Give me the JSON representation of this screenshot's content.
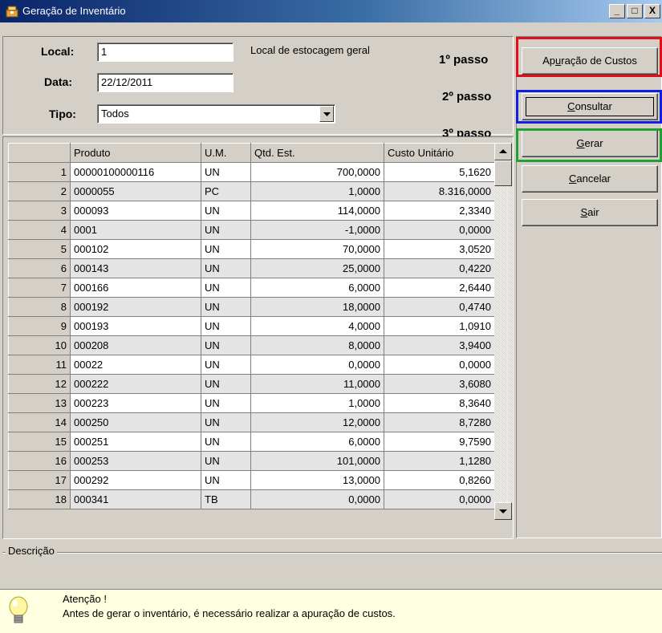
{
  "window": {
    "title": "Geração de Inventário",
    "minimize": "_",
    "maximize": "□",
    "close": "X"
  },
  "form": {
    "local_label": "Local:",
    "local_value": "1",
    "local_desc": "Local de estocagem geral",
    "data_label": "Data:",
    "data_value": "22/12/2011",
    "tipo_label": "Tipo:",
    "tipo_value": "Todos"
  },
  "steps": {
    "s1": "1º passo",
    "s2": "2º passo",
    "s3": "3º passo"
  },
  "buttons": {
    "apuracao_pre": "Ap",
    "apuracao_u": "u",
    "apuracao_post": "ração de Custos",
    "consultar_u": "C",
    "consultar_post": "onsultar",
    "gerar_u": "G",
    "gerar_post": "erar",
    "cancelar_u": "C",
    "cancelar_post": "ancelar",
    "sair_u": "S",
    "sair_post": "air"
  },
  "highlight_colors": {
    "step1": "#e0101a",
    "step2": "#1020e0",
    "step3": "#20a030"
  },
  "grid": {
    "columns": [
      "Produto",
      "U.M.",
      "Qtd. Est.",
      "Custo Unitário"
    ],
    "rows": [
      {
        "n": "1",
        "produto": "00000100000116",
        "um": "UN",
        "qtd": "700,0000",
        "custo": "5,1620"
      },
      {
        "n": "2",
        "produto": "0000055",
        "um": "PC",
        "qtd": "1,0000",
        "custo": "8.316,0000"
      },
      {
        "n": "3",
        "produto": "000093",
        "um": "UN",
        "qtd": "114,0000",
        "custo": "2,3340"
      },
      {
        "n": "4",
        "produto": "0001",
        "um": "UN",
        "qtd": "-1,0000",
        "custo": "0,0000"
      },
      {
        "n": "5",
        "produto": "000102",
        "um": "UN",
        "qtd": "70,0000",
        "custo": "3,0520"
      },
      {
        "n": "6",
        "produto": "000143",
        "um": "UN",
        "qtd": "25,0000",
        "custo": "0,4220"
      },
      {
        "n": "7",
        "produto": "000166",
        "um": "UN",
        "qtd": "6,0000",
        "custo": "2,6440"
      },
      {
        "n": "8",
        "produto": "000192",
        "um": "UN",
        "qtd": "18,0000",
        "custo": "0,4740"
      },
      {
        "n": "9",
        "produto": "000193",
        "um": "UN",
        "qtd": "4,0000",
        "custo": "1,0910"
      },
      {
        "n": "10",
        "produto": "000208",
        "um": "UN",
        "qtd": "8,0000",
        "custo": "3,9400"
      },
      {
        "n": "11",
        "produto": "00022",
        "um": "UN",
        "qtd": "0,0000",
        "custo": "0,0000"
      },
      {
        "n": "12",
        "produto": "000222",
        "um": "UN",
        "qtd": "11,0000",
        "custo": "3,6080"
      },
      {
        "n": "13",
        "produto": "000223",
        "um": "UN",
        "qtd": "1,0000",
        "custo": "8,3640"
      },
      {
        "n": "14",
        "produto": "000250",
        "um": "UN",
        "qtd": "12,0000",
        "custo": "8,7280"
      },
      {
        "n": "15",
        "produto": "000251",
        "um": "UN",
        "qtd": "6,0000",
        "custo": "9,7590"
      },
      {
        "n": "16",
        "produto": "000253",
        "um": "UN",
        "qtd": "101,0000",
        "custo": "1,1280"
      },
      {
        "n": "17",
        "produto": "000292",
        "um": "UN",
        "qtd": "13,0000",
        "custo": "0,8260"
      },
      {
        "n": "18",
        "produto": "000341",
        "um": "TB",
        "qtd": "0,0000",
        "custo": "0,0000"
      }
    ]
  },
  "descricao": {
    "label": "Descrição"
  },
  "attention": {
    "title": "Atenção !",
    "message": "Antes de gerar o inventário, é necessário realizar a apuração de custos."
  }
}
